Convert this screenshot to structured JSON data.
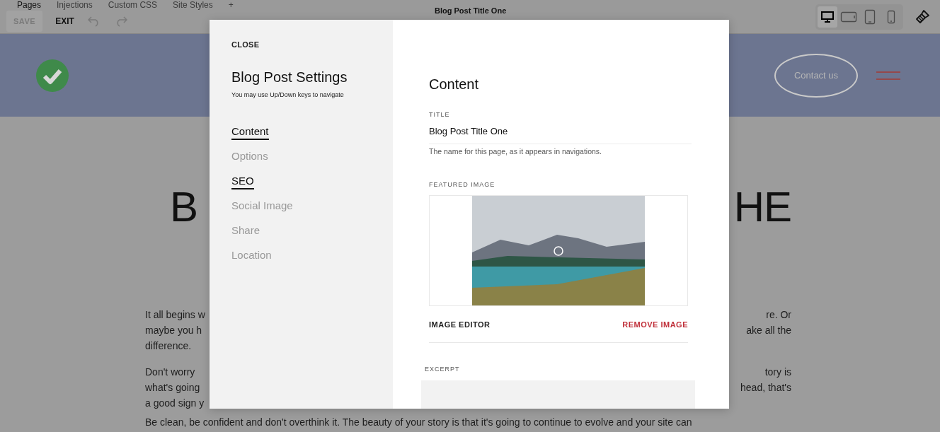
{
  "toolbar": {
    "tabs": [
      {
        "label": "Pages",
        "selected": true
      },
      {
        "label": "Injections",
        "selected": false
      },
      {
        "label": "Custom CSS",
        "selected": false
      },
      {
        "label": "Site Styles",
        "selected": false
      }
    ],
    "add": "+",
    "save": {
      "label": "SAVE",
      "disabled": true
    },
    "exit": "EXIT",
    "page_title": "Blog Post Title One",
    "devices": [
      {
        "kind": "desktop",
        "selected": true
      },
      {
        "kind": "tablet-landscape",
        "selected": false
      },
      {
        "kind": "tablet",
        "selected": false
      },
      {
        "kind": "phone",
        "selected": false
      }
    ]
  },
  "site_header": {
    "contact_button": "Contact us"
  },
  "article": {
    "heading": [
      "B",
      "HE"
    ],
    "paragraphs": [
      [
        [
          "It all begins w",
          "re. Or"
        ],
        [
          "maybe you h",
          "ake all the"
        ],
        [
          "difference."
        ]
      ],
      [
        [
          "Don't worry",
          "tory is"
        ],
        [
          "what's going",
          "head, that's"
        ],
        [
          "a good sign y"
        ]
      ],
      [
        [
          "Be clean, be confident and don't overthink it. The beauty of your story is that it's going to continue to evolve and your site can"
        ]
      ]
    ]
  },
  "modal": {
    "close": "CLOSE",
    "title": "Blog Post Settings",
    "hint": "You may use Up/Down keys to navigate",
    "nav": [
      {
        "label": "Content",
        "selected": true
      },
      {
        "label": "Options",
        "selected": false
      },
      {
        "label": "SEO",
        "selected": true
      },
      {
        "label": "Social Image",
        "selected": false
      },
      {
        "label": "Share",
        "selected": false
      },
      {
        "label": "Location",
        "selected": false
      }
    ],
    "content": {
      "heading": "Content",
      "title_field": {
        "label": "TITLE",
        "value": "Blog Post Title One",
        "help": "The name for this page, as it appears in navigations."
      },
      "featured_image": {
        "label": "FEATURED IMAGE",
        "editor": "IMAGE EDITOR",
        "remove": "REMOVE IMAGE"
      },
      "excerpt": {
        "label": "EXCERPT"
      }
    }
  }
}
